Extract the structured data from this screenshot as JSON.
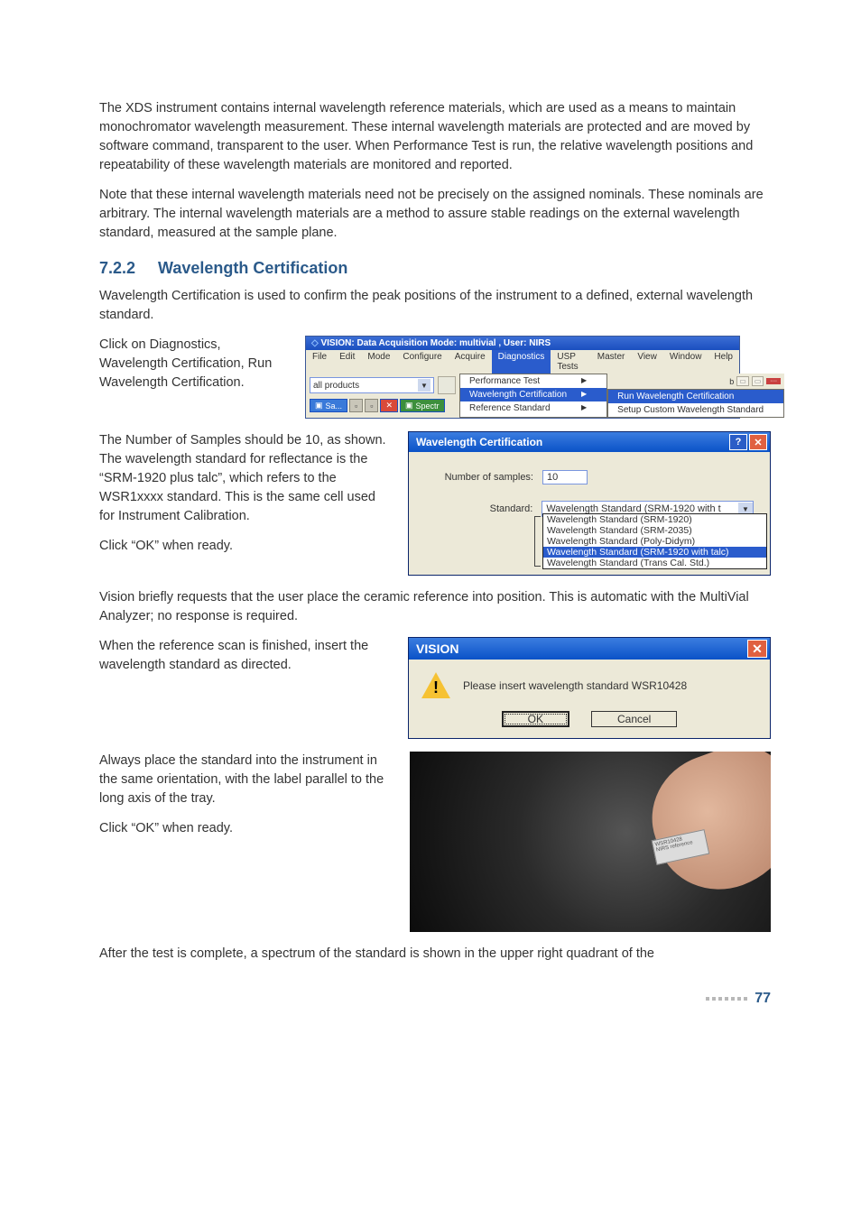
{
  "section": {
    "number": "7.2.2",
    "title": "Wavelength Certification"
  },
  "paragraphs": {
    "intro1": "The XDS instrument contains internal wavelength reference materials, which are used as a means to maintain monochromator wavelength measurement. These internal wavelength materials are protected and are moved by software command, transparent to the user. When Performance Test is run, the relative wavelength positions and repeatability of these wavelength materials are monitored and reported.",
    "intro2": "Note that these internal wavelength materials need not be precisely on the assigned nominals. These nominals are arbitrary. The internal wavelength materials are a method to assure stable readings on the external wavelength standard, measured at the sample plane.",
    "wc_intro": "Wavelength Certification is used to confirm the peak positions of the instrument to a defined, external wavelength standard.",
    "click_diag": "Click on Diagnostics, Wavelength Certification, Run Wavelength Certification.",
    "num_samples": "The Number of Samples should be 10, as shown. The wavelength standard for reflectance is the “SRM-1920 plus talc”, which refers to the WSR1xxxx standard. This is the same cell used for Instrument Calibration.",
    "click_ok1": "Click “OK” when ready.",
    "vision_brief": "Vision briefly requests that the user place the ceramic reference into position. This is automatic with the MultiVial Analyzer; no response is required.",
    "when_ref": "When the reference scan is finished, insert the wavelength standard as directed.",
    "always_place": "Always place the standard into the instrument in the same orientation, with the label parallel to the long axis of the tray.",
    "click_ok2": "Click “OK” when ready.",
    "after_test": "After the test is complete, a spectrum of the standard is shown in the upper right quadrant of the"
  },
  "app_window": {
    "title": "VISION: Data Acquisition Mode: multivial , User: NIRS",
    "menus": [
      "File",
      "Edit",
      "Mode",
      "Configure",
      "Acquire",
      "Diagnostics",
      "USP Tests",
      "Master",
      "View",
      "Window",
      "Help"
    ],
    "open_menu": "Diagnostics",
    "combo_value": "all products",
    "diag_items": [
      "Performance Test",
      "Wavelength Certification",
      "Reference Standard"
    ],
    "diag_selected": "Wavelength Certification",
    "sub_items": [
      "Run Wavelength Certification",
      "Setup Custom Wavelength Standard"
    ],
    "sub_selected": "Run Wavelength Certification",
    "task_buttons": [
      "Sa...",
      "Spectr"
    ]
  },
  "wc_dialog": {
    "title": "Wavelength Certification",
    "num_samples_label": "Number of samples:",
    "num_samples_value": "10",
    "standard_label": "Standard:",
    "standard_value": "Wavelength Standard (SRM-1920 with t",
    "options": [
      "Wavelength Standard (SRM-1920)",
      "Wavelength Standard (SRM-2035)",
      "Wavelength Standard (Poly-Didym)",
      "Wavelength Standard (SRM-1920 with talc)",
      "Wavelength Standard (Trans Cal. Std.)"
    ],
    "selected_option": "Wavelength Standard (SRM-1920 with talc)"
  },
  "msgbox": {
    "title": "VISION",
    "text": "Please insert wavelength standard WSR10428",
    "ok": "OK",
    "cancel": "Cancel"
  },
  "photo": {
    "chip_line1": "WSR10428",
    "chip_line2": "NIRS reference"
  },
  "footer": {
    "page": "77"
  }
}
